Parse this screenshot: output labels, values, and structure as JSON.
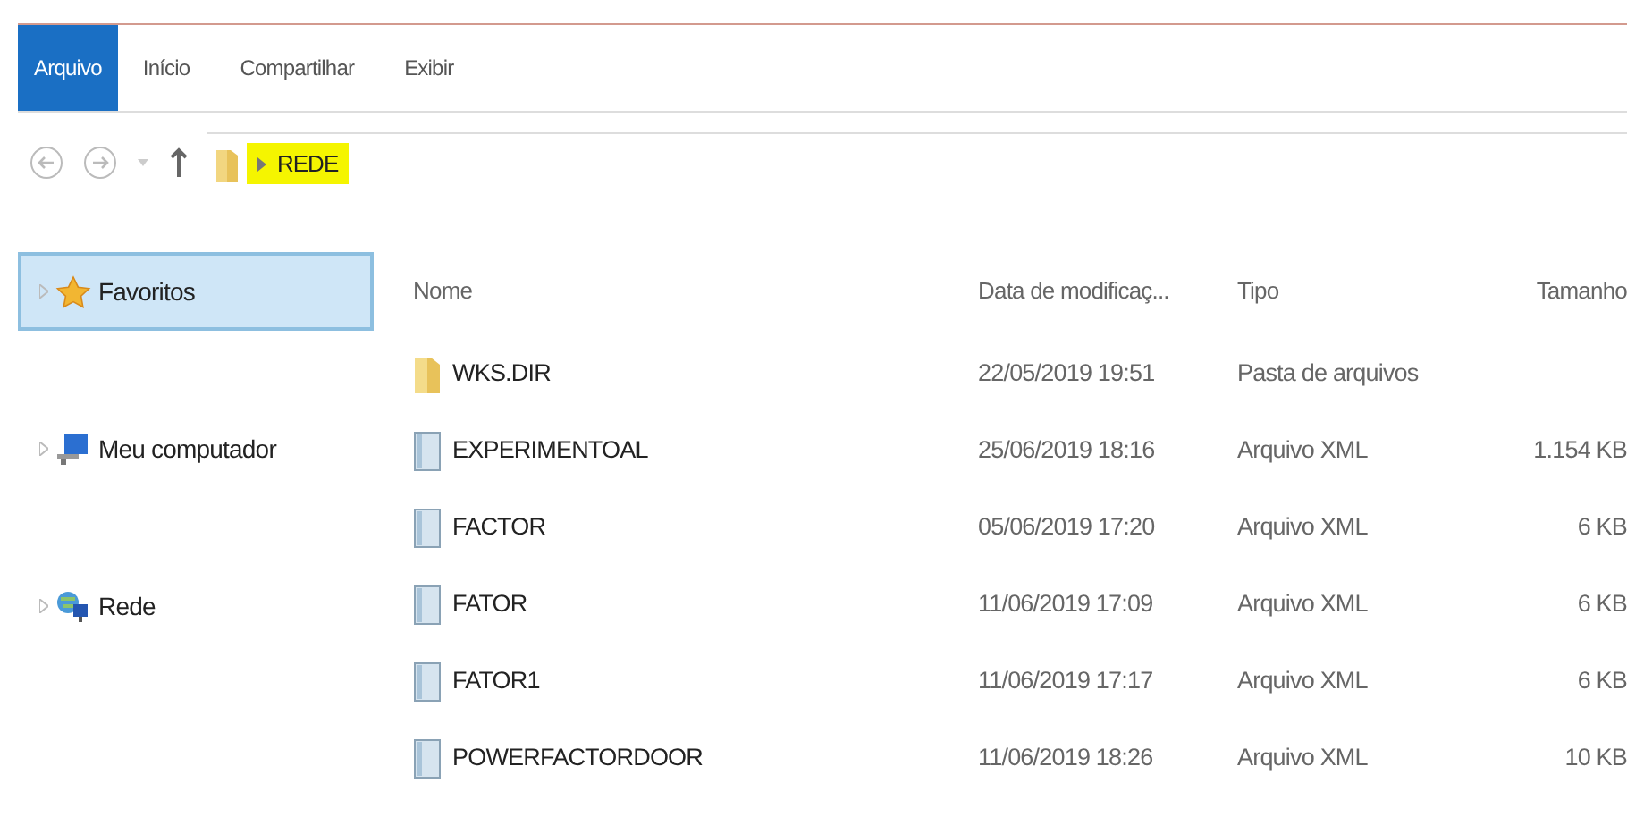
{
  "ribbon": {
    "tabs": [
      {
        "label": "Arquivo",
        "selected": true
      },
      {
        "label": "Início",
        "selected": false
      },
      {
        "label": "Compartilhar",
        "selected": false
      },
      {
        "label": "Exibir",
        "selected": false
      }
    ]
  },
  "address_bar": {
    "path": [
      {
        "label": "REDE",
        "highlighted": true
      }
    ]
  },
  "sidebar": {
    "items": [
      {
        "label": "Favoritos",
        "kind": "favorites",
        "selected": true
      },
      {
        "label": "Meu computador",
        "kind": "computer",
        "selected": false
      },
      {
        "label": "Rede",
        "kind": "network",
        "selected": false
      }
    ]
  },
  "table": {
    "columns": [
      "Nome",
      "Data de modificaç...",
      "Tipo",
      "Tamanho"
    ],
    "rows": [
      {
        "kind": "folder",
        "name": "WKS.DIR",
        "date": "22/05/2019 19:51",
        "type": "Pasta de arquivos",
        "size": ""
      },
      {
        "kind": "file",
        "name": "EXPERIMENTOAL",
        "date": "25/06/2019 18:16",
        "type": "Arquivo XML",
        "size": "1.154 KB"
      },
      {
        "kind": "file",
        "name": "FACTOR",
        "date": "05/06/2019 17:20",
        "type": "Arquivo XML",
        "size": "6 KB"
      },
      {
        "kind": "file",
        "name": "FATOR",
        "date": "11/06/2019 17:09",
        "type": "Arquivo XML",
        "size": "6 KB"
      },
      {
        "kind": "file",
        "name": "FATOR1",
        "date": "11/06/2019 17:17",
        "type": "Arquivo XML",
        "size": "6 KB"
      },
      {
        "kind": "file",
        "name": "POWERFACTORDOOR",
        "date": "11/06/2019 18:26",
        "type": "Arquivo XML",
        "size": "10 KB"
      }
    ]
  }
}
